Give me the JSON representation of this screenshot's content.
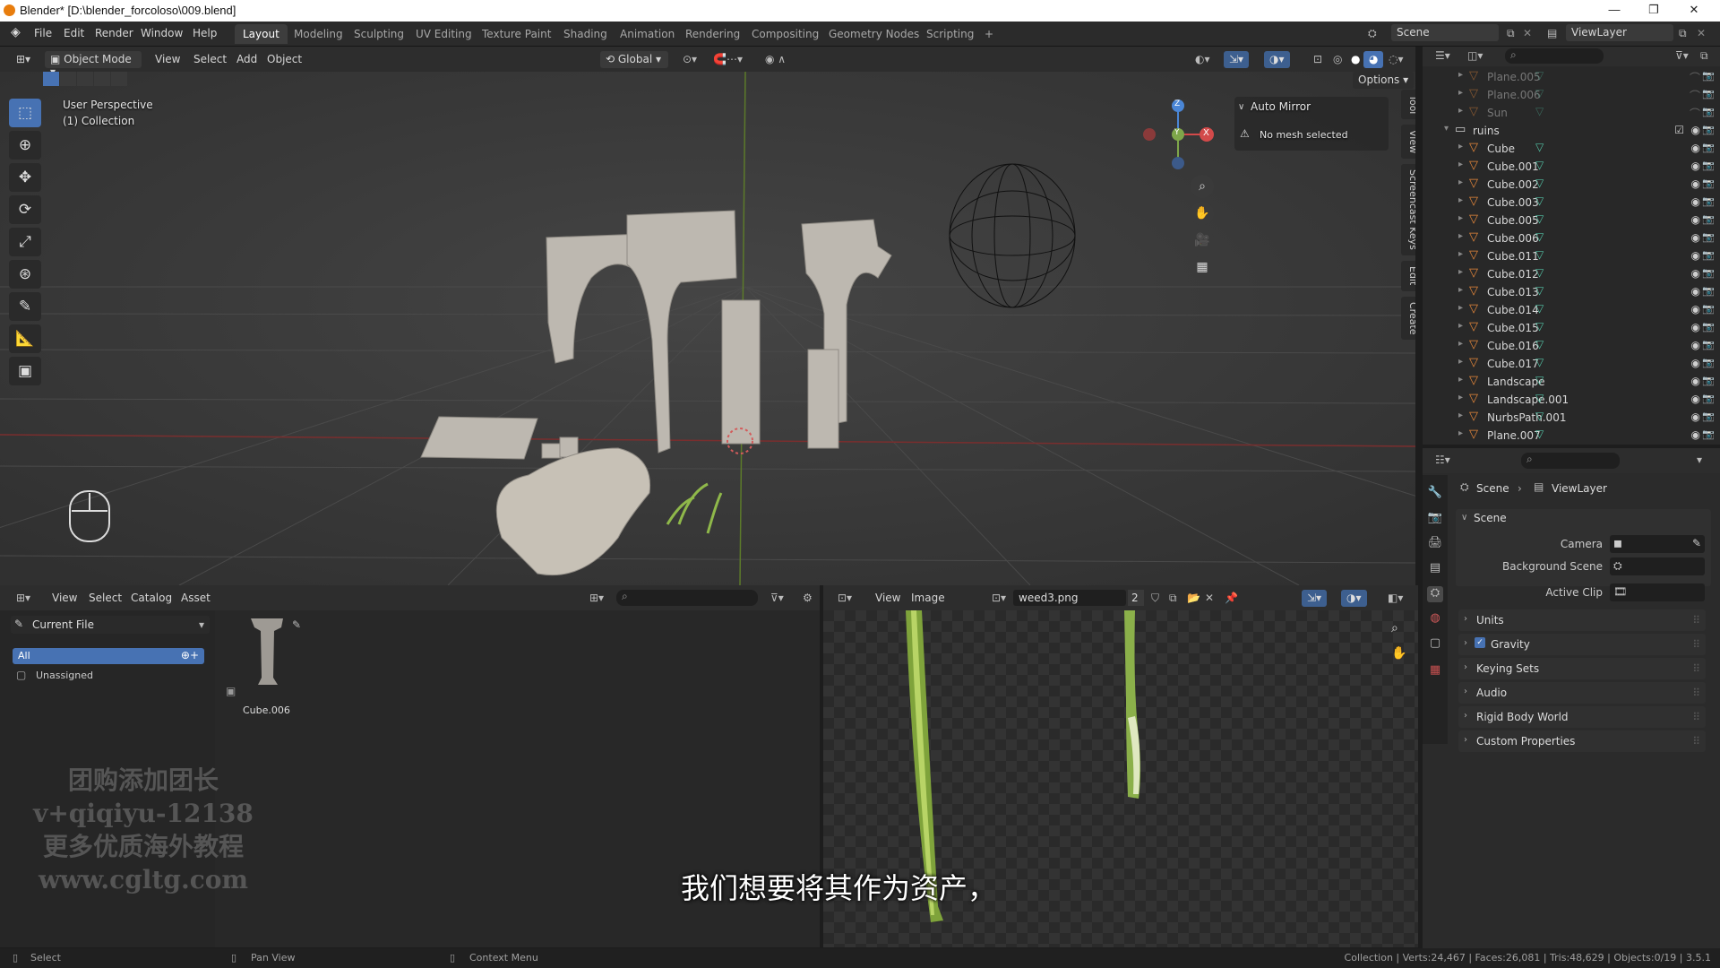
{
  "window": {
    "title": "Blender* [D:\\blender_forcoloso\\009.blend]",
    "min": "—",
    "max": "❐",
    "close": "✕"
  },
  "menu": {
    "items": [
      "File",
      "Edit",
      "Render",
      "Window",
      "Help"
    ]
  },
  "workspaces": {
    "tabs": [
      "Layout",
      "Modeling",
      "Sculpting",
      "UV Editing",
      "Texture Paint",
      "Shading",
      "Animation",
      "Rendering",
      "Compositing",
      "Geometry Nodes",
      "Scripting",
      "+"
    ],
    "active": "Layout"
  },
  "topright": {
    "scene": "Scene",
    "viewlayer": "ViewLayer"
  },
  "viewport_header": {
    "mode": "Object Mode",
    "view": "View",
    "select": "Select",
    "add": "Add",
    "object": "Object",
    "orientation": "Global",
    "options": "Options"
  },
  "viewport": {
    "perspective": "User Perspective",
    "collection": "(1) Collection",
    "auto_mirror": "Auto Mirror",
    "no_mesh": "No mesh selected",
    "side_tabs": [
      "Tool",
      "View",
      "Screencast Keys",
      "Edit",
      "Create"
    ]
  },
  "gizmo": {
    "x": "X",
    "y": "Y",
    "z": "Z"
  },
  "outliner": {
    "rows": [
      {
        "name": "Plane.005",
        "dim": true
      },
      {
        "name": "Plane.006",
        "dim": true
      },
      {
        "name": "Sun",
        "dim": true
      },
      {
        "name": "ruins",
        "collection": true
      },
      {
        "name": "Cube"
      },
      {
        "name": "Cube.001"
      },
      {
        "name": "Cube.002"
      },
      {
        "name": "Cube.003"
      },
      {
        "name": "Cube.005"
      },
      {
        "name": "Cube.006"
      },
      {
        "name": "Cube.011"
      },
      {
        "name": "Cube.012"
      },
      {
        "name": "Cube.013"
      },
      {
        "name": "Cube.014"
      },
      {
        "name": "Cube.015"
      },
      {
        "name": "Cube.016"
      },
      {
        "name": "Cube.017"
      },
      {
        "name": "Landscape"
      },
      {
        "name": "Landscape.001"
      },
      {
        "name": "NurbsPath.001"
      },
      {
        "name": "Plane.007"
      }
    ]
  },
  "properties": {
    "breadcrumb_scene": "Scene",
    "breadcrumb_layer": "ViewLayer",
    "panel_scene": "Scene",
    "camera_label": "Camera",
    "bg_scene_label": "Background Scene",
    "active_clip_label": "Active Clip",
    "panels": [
      "Units",
      "Gravity",
      "Keying Sets",
      "Audio",
      "Rigid Body World",
      "Custom Properties"
    ]
  },
  "asset_browser": {
    "menus": [
      "View",
      "Select",
      "Catalog",
      "Asset"
    ],
    "library": "Current File",
    "catalogs": [
      "All",
      "Unassigned"
    ],
    "asset_name": "Cube.006"
  },
  "image_editor": {
    "view": "View",
    "image": "Image",
    "filename": "weed3.png",
    "users": "2"
  },
  "status": {
    "select": "Select",
    "pan": "Pan View",
    "context": "Context Menu",
    "stats": "Collection | Verts:24,467 | Faces:26,081 | Tris:48,629 | Objects:0/19 | 3.5.1"
  },
  "watermark": {
    "lines": [
      "团购添加团长",
      "v+qiqiyu-12138",
      "更多优质海外教程",
      "www.cgltg.com"
    ]
  },
  "subtitle": "我们想要将其作为资产，"
}
